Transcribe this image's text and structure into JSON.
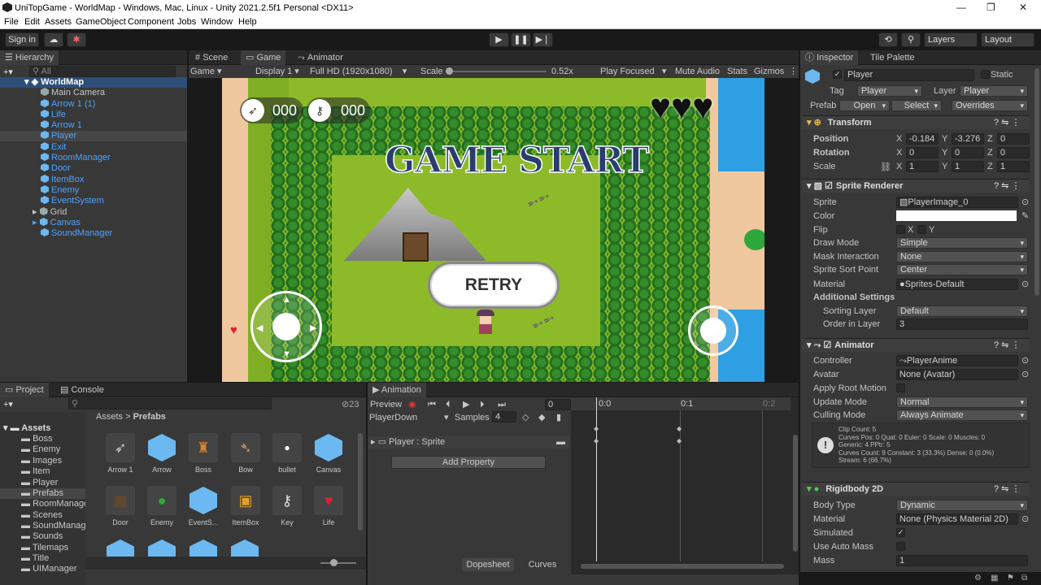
{
  "window": {
    "title": "UniTopGame - WorldMap - Windows, Mac, Linux - Unity 2021.2.5f1 Personal <DX11>"
  },
  "menu": [
    "File",
    "Edit",
    "Assets",
    "GameObject",
    "Component",
    "Jobs",
    "Window",
    "Help"
  ],
  "toolbar": {
    "sign_in": "Sign in",
    "layers": "Layers",
    "layout": "Layout"
  },
  "hierarchy": {
    "tab": "Hierarchy",
    "search_placeholder": "All",
    "root": "WorldMap",
    "items": [
      "Main Camera",
      "Arrow 1 (1)",
      "Life",
      "Arrow 1",
      "Player",
      "Exit",
      "RoomManager",
      "Door",
      "ItemBox",
      "Enemy",
      "EventSystem",
      "Grid",
      "Canvas",
      "SoundManager"
    ]
  },
  "game_view": {
    "tabs": [
      "Scene",
      "Game",
      "Animator"
    ],
    "display_mode": "Game",
    "display": "Display 1",
    "resolution": "Full HD (1920x1080)",
    "scale_label": "Scale",
    "scale_value": "0.52x",
    "play_focused": "Play Focused",
    "mute": "Mute Audio",
    "stats": "Stats",
    "gizmos": "Gizmos",
    "arrow_count": "000",
    "key_count": "000",
    "title": "GAME START",
    "retry": "RETRY"
  },
  "project": {
    "tabs": [
      "Project",
      "Console"
    ],
    "count": "23",
    "folders": [
      "Assets",
      "Boss",
      "Enemy",
      "Images",
      "Item",
      "Player",
      "Prefabs",
      "RoomManager",
      "Scenes",
      "SoundManager",
      "Sounds",
      "Tilemaps",
      "Title",
      "UIManager"
    ],
    "breadcrumb": [
      "Assets",
      "Prefabs"
    ],
    "assets": [
      "Arrow 1",
      "Arrow",
      "Boss",
      "Bow",
      "bullet",
      "Canvas",
      "Door",
      "Enemy",
      "EventS...",
      "ItemBox",
      "Key",
      "Life"
    ]
  },
  "animation": {
    "tab": "Animation",
    "preview": "Preview",
    "frame": "0",
    "clip": "PlayerDown",
    "samples_label": "Samples",
    "samples": "4",
    "property": "Player : Sprite",
    "add_property": "Add Property",
    "time_marks": [
      "0:0",
      "0:1",
      "0:2"
    ],
    "dopesheet": "Dopesheet",
    "curves": "Curves"
  },
  "inspector": {
    "tabs": [
      "Inspector",
      "Tile Palette"
    ],
    "name": "Player",
    "static": "Static",
    "tag_label": "Tag",
    "tag": "Player",
    "layer_label": "Layer",
    "layer": "Player",
    "prefab_label": "Prefab",
    "open": "Open",
    "select": "Select",
    "overrides": "Overrides",
    "transform": {
      "title": "Transform",
      "position_label": "Position",
      "rotation_label": "Rotation",
      "scale_label": "Scale",
      "pos_x": "-0.184",
      "pos_y": "-3.276",
      "pos_z": "0",
      "rot_x": "0",
      "rot_y": "0",
      "rot_z": "0",
      "scale_x": "1",
      "scale_y": "1",
      "scale_z": "1"
    },
    "sprite_renderer": {
      "title": "Sprite Renderer",
      "sprite_label": "Sprite",
      "sprite": "PlayerImage_0",
      "color_label": "Color",
      "flip_label": "Flip",
      "flip_x": "X",
      "flip_y": "Y",
      "draw_mode_label": "Draw Mode",
      "draw_mode": "Simple",
      "mask_label": "Mask Interaction",
      "mask": "None",
      "sort_point_label": "Sprite Sort Point",
      "sort_point": "Center",
      "material_label": "Material",
      "material": "Sprites-Default",
      "additional": "Additional Settings",
      "sorting_layer_label": "Sorting Layer",
      "sorting_layer": "Default",
      "order_label": "Order in Layer",
      "order": "3"
    },
    "animator": {
      "title": "Animator",
      "controller_label": "Controller",
      "controller": "PlayerAnime",
      "avatar_label": "Avatar",
      "avatar": "None (Avatar)",
      "root_motion_label": "Apply Root Motion",
      "update_label": "Update Mode",
      "update": "Normal",
      "culling_label": "Culling Mode",
      "culling": "Always Animate",
      "info": [
        "Clip Count: 5",
        "Curves Pos: 0 Quat: 0 Euler: 0 Scale: 0 Muscles: 0",
        "Generic: 4 PPtr: 5",
        "Curves Count: 9 Constant: 3 (33.3%) Dense: 0 (0.0%)",
        "Stream: 6 (66.7%)"
      ]
    },
    "rigidbody": {
      "title": "Rigidbody 2D",
      "body_type_label": "Body Type",
      "body_type": "Dynamic",
      "material_label": "Material",
      "material": "None (Physics Material 2D)",
      "simulated_label": "Simulated",
      "auto_mass_label": "Use Auto Mass",
      "mass_label": "Mass",
      "mass": "1"
    }
  },
  "colors": {
    "accent": "#4da3ff",
    "panel": "#383838",
    "grass": "#8dba29",
    "water": "#2f9fe3"
  }
}
